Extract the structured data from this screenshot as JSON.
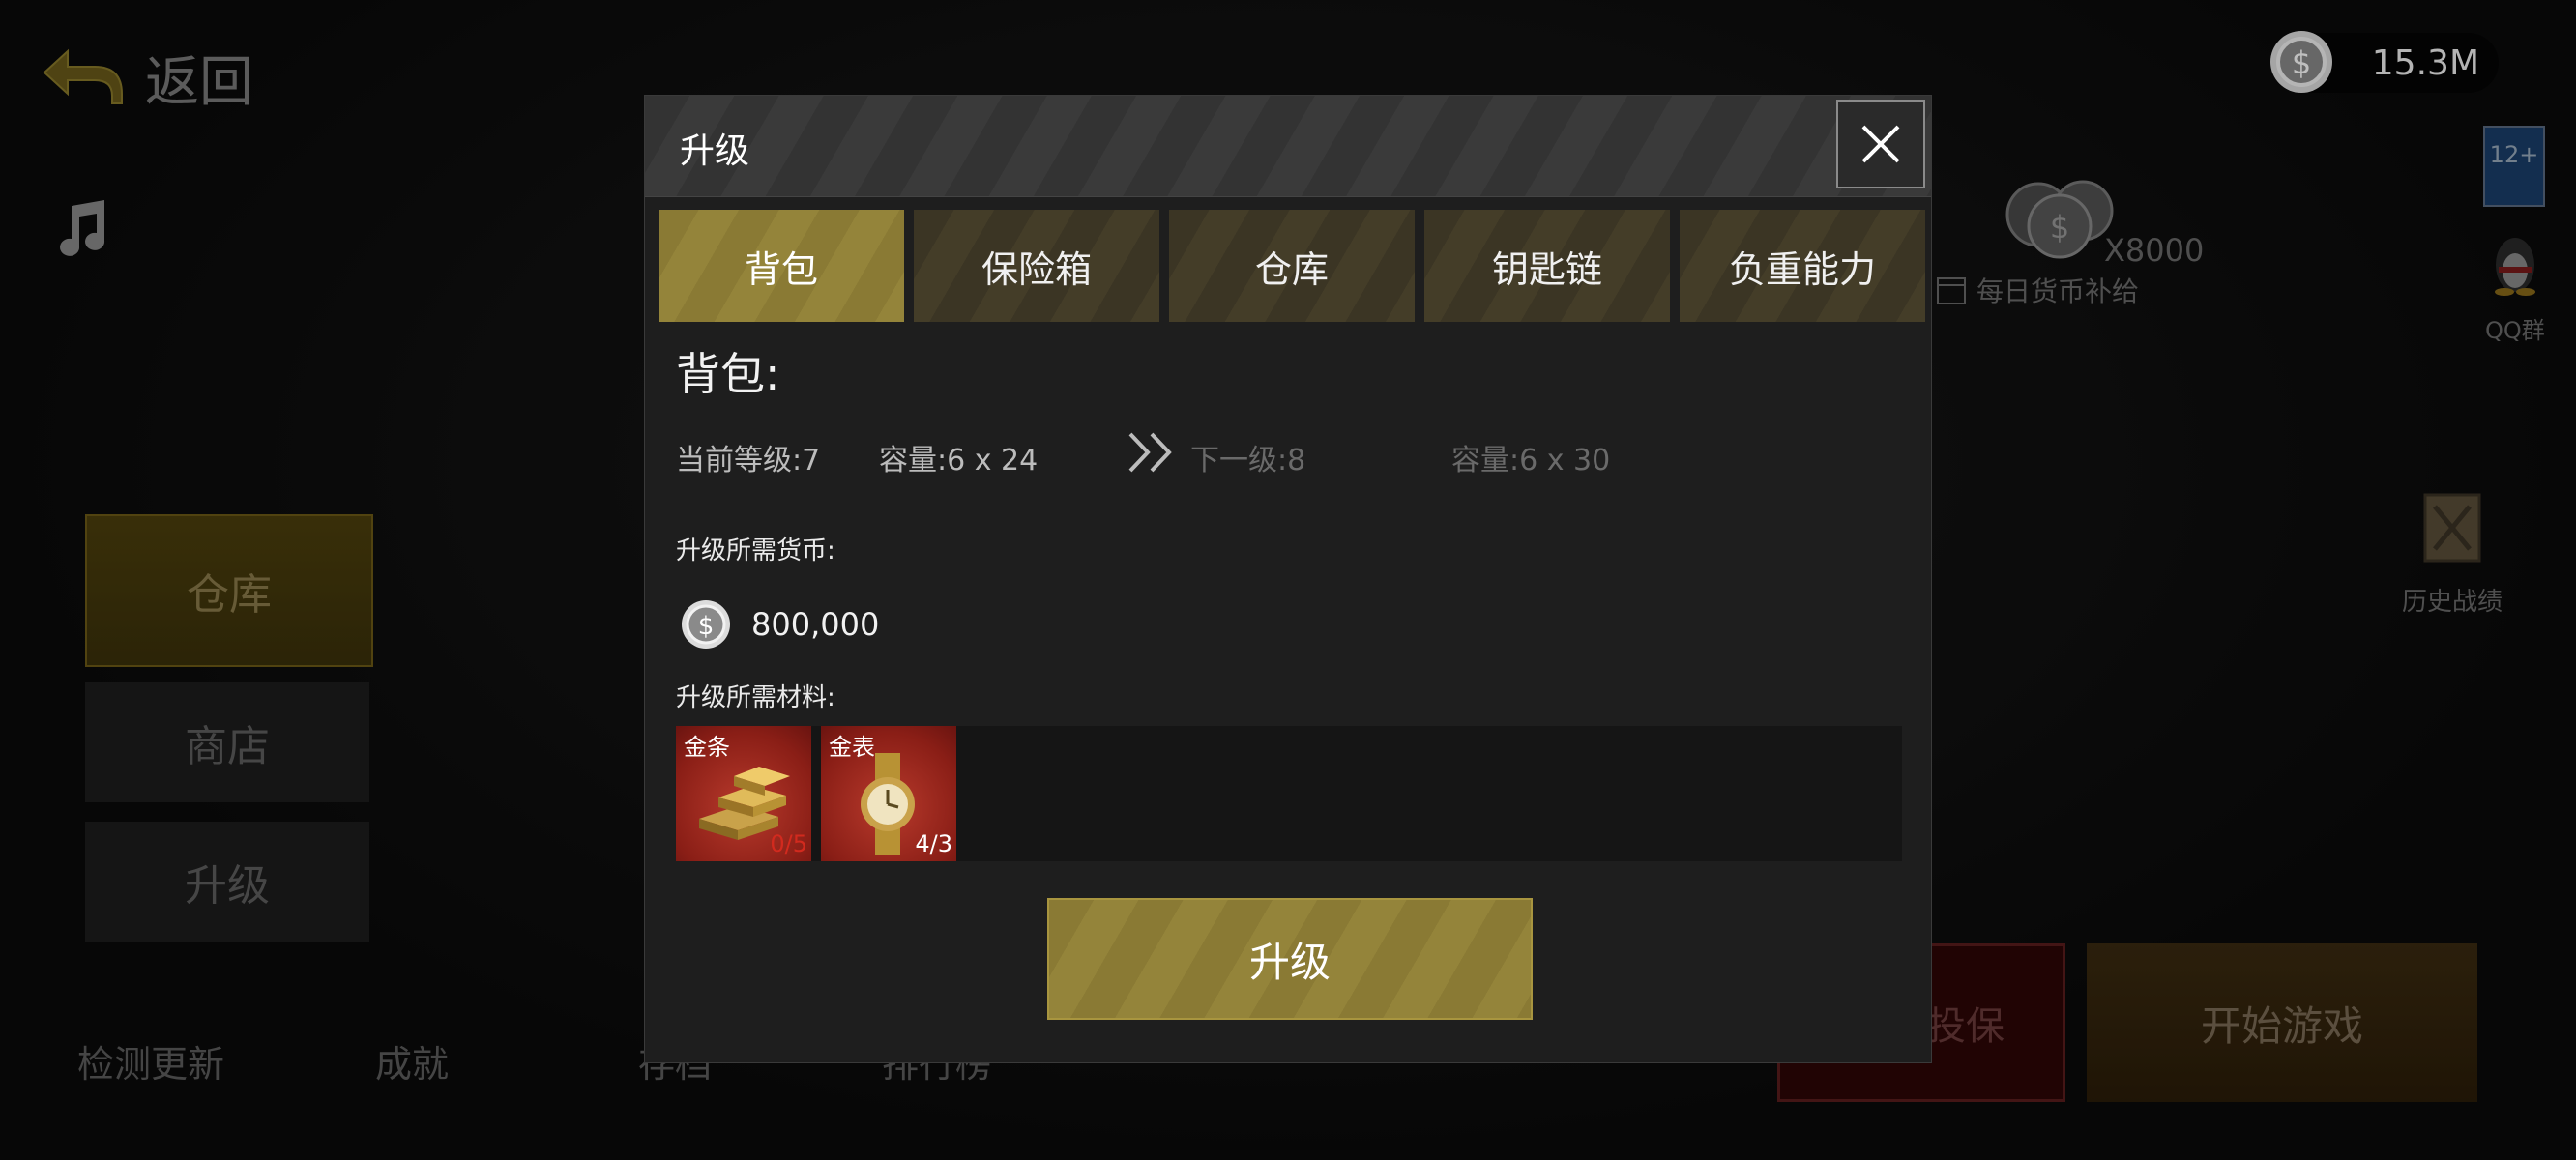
{
  "background": {
    "back_label": "返回",
    "side_items": [
      "仓库",
      "商店",
      "升级"
    ],
    "bottom_nav": [
      "检测更新",
      "成就",
      "存档",
      "排行榜"
    ],
    "coin_balance": "15.3M",
    "daily_coin_amount": "X8000",
    "daily_coin_label": "每日货币补给",
    "rating_badge": "12+",
    "qq_label": "QQ群",
    "history_label": "历史战绩",
    "insure_button": "投保",
    "start_button": "开始游戏"
  },
  "modal": {
    "title": "升级",
    "tabs": [
      "背包",
      "保险箱",
      "仓库",
      "钥匙链",
      "负重能力"
    ],
    "active_tab": "背包",
    "section_title": "背包:",
    "current_level_label": "当前等级:7",
    "current_capacity_label": "容量:6 x 24",
    "next_level_label": "下一级:8",
    "next_capacity_label": "容量:6 x 30",
    "currency_label": "升级所需货币:",
    "currency_value": "800,000",
    "materials_label": "升级所需材料:",
    "materials": [
      {
        "name": "金条",
        "count": "0/5",
        "count_color": "#d22a1e",
        "icon": "gold-bar-icon"
      },
      {
        "name": "金表",
        "count": "4/3",
        "count_color": "#ffffff",
        "icon": "gold-watch-icon"
      }
    ],
    "upgrade_button": "升级"
  },
  "colors": {
    "accent_gold": "#8a7a34",
    "material_bg_red": "#8a1e16",
    "insufficient_red": "#d22a1e"
  }
}
